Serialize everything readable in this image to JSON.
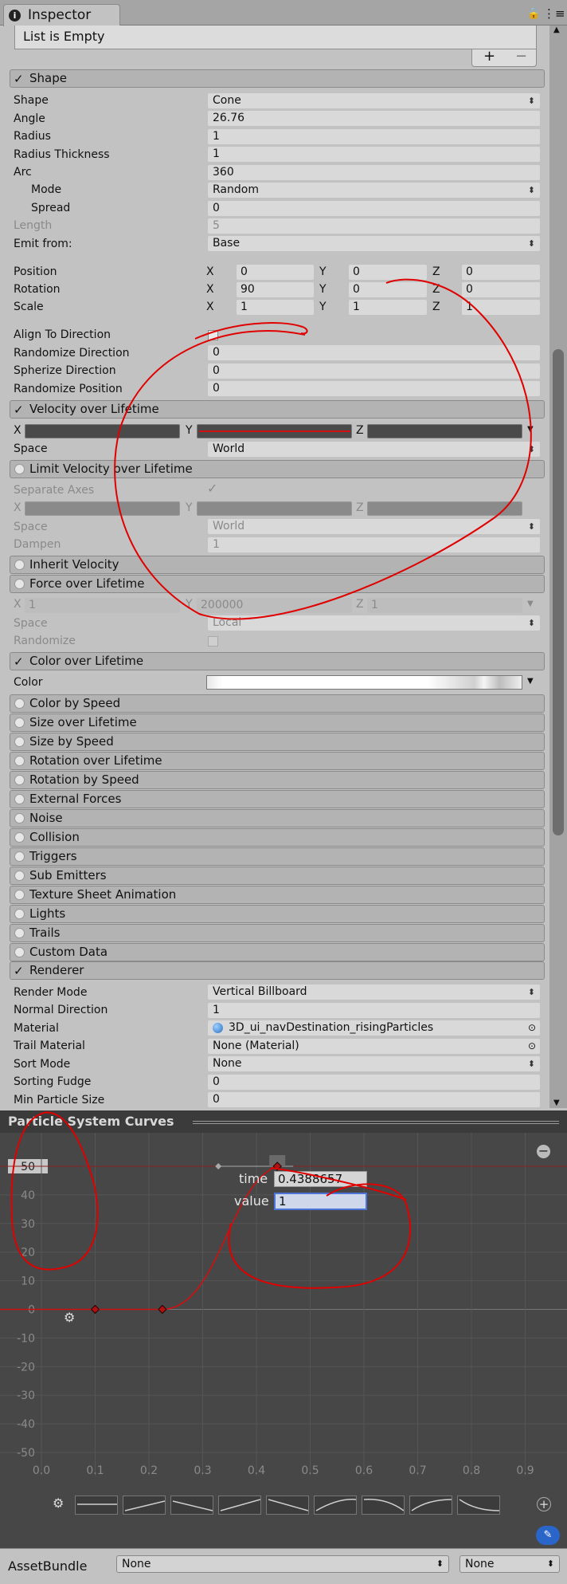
{
  "window": {
    "tab_title": "Inspector"
  },
  "list": {
    "empty_text": "List is Empty",
    "plus": "+",
    "minus": "−"
  },
  "shape": {
    "header": "Shape",
    "rows": [
      {
        "label": "Shape",
        "value": "Cone"
      },
      {
        "label": "Angle",
        "value": "26.76"
      },
      {
        "label": "Radius",
        "value": "1"
      },
      {
        "label": "Radius Thickness",
        "value": "1"
      },
      {
        "label": "Arc",
        "value": "360"
      },
      {
        "label": "Mode",
        "value": "Random"
      },
      {
        "label": "Spread",
        "value": "0"
      },
      {
        "label": "Length",
        "value": "5"
      },
      {
        "label": "Emit from:",
        "value": "Base"
      }
    ],
    "position": {
      "label": "Position",
      "x": "0",
      "y": "0",
      "z": "0"
    },
    "rotation": {
      "label": "Rotation",
      "x": "90",
      "y": "0",
      "z": "0"
    },
    "scale": {
      "label": "Scale",
      "x": "1",
      "y": "1",
      "z": "1"
    },
    "align": {
      "label": "Align To Direction"
    },
    "randomize_direction": {
      "label": "Randomize Direction",
      "value": "0"
    },
    "spherize_direction": {
      "label": "Spherize Direction",
      "value": "0"
    },
    "randomize_position": {
      "label": "Randomize Position",
      "value": "0"
    }
  },
  "axes": {
    "x": "X",
    "y": "Y",
    "z": "Z"
  },
  "velocity": {
    "header": "Velocity over Lifetime",
    "space_label": "Space",
    "space_value": "World"
  },
  "limit_velocity": {
    "header": "Limit Velocity over Lifetime",
    "separate_axes": "Separate Axes",
    "space_label": "Space",
    "space_value": "World",
    "dampen_label": "Dampen",
    "dampen_value": "1"
  },
  "inherit_velocity": {
    "header": "Inherit Velocity"
  },
  "force": {
    "header": "Force over Lifetime",
    "x": "1",
    "y": "200000",
    "z": "1",
    "space_label": "Space",
    "space_value": "Local",
    "randomize_label": "Randomize"
  },
  "color_lifetime": {
    "header": "Color over Lifetime",
    "color_label": "Color"
  },
  "modules": [
    "Color by Speed",
    "Size over Lifetime",
    "Size by Speed",
    "Rotation over Lifetime",
    "Rotation by Speed",
    "External Forces",
    "Noise",
    "Collision",
    "Triggers",
    "Sub Emitters",
    "Texture Sheet Animation",
    "Lights",
    "Trails",
    "Custom Data"
  ],
  "renderer": {
    "header": "Renderer",
    "rows": [
      {
        "label": "Render Mode",
        "value": "Vertical Billboard"
      },
      {
        "label": "Normal Direction",
        "value": "1"
      },
      {
        "label": "Material",
        "value": "3D_ui_navDestination_risingParticles"
      },
      {
        "label": "Trail Material",
        "value": "None (Material)"
      },
      {
        "label": "Sort Mode",
        "value": "None"
      },
      {
        "label": "Sorting Fudge",
        "value": "0"
      },
      {
        "label": "Min Particle Size",
        "value": "0"
      }
    ]
  },
  "curves": {
    "title": "Particle System Curves",
    "time_label": "time",
    "time_value": "0.4388657",
    "value_label": "value",
    "value_value": "1",
    "y_ticks": [
      "50",
      "40",
      "30",
      "20",
      "10",
      "0",
      "-10",
      "-20",
      "-30",
      "-40",
      "-50"
    ],
    "x_ticks": [
      "0.0",
      "0.1",
      "0.2",
      "0.3",
      "0.4",
      "0.5",
      "0.6",
      "0.7",
      "0.8",
      "0.9"
    ],
    "keys": [
      {
        "t": 0.1,
        "v": 0
      },
      {
        "t": 0.225,
        "v": 0
      },
      {
        "t": 0.4388657,
        "v": 50
      }
    ]
  },
  "bottom": {
    "label": "AssetBundle",
    "bundle": "None",
    "variant": "None"
  },
  "colors": {
    "annotation": "#e00000",
    "curve": "#d01010"
  }
}
